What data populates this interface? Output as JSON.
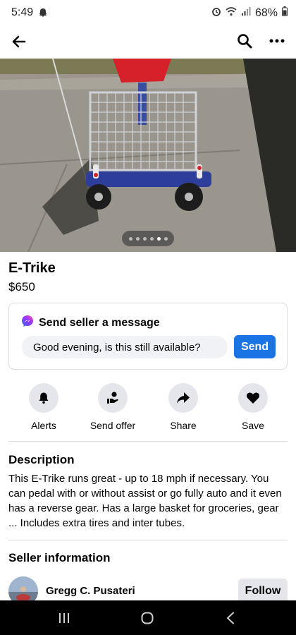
{
  "status": {
    "time": "5:49",
    "battery": "68%"
  },
  "listing": {
    "title": "E-Trike",
    "price": "$650"
  },
  "message": {
    "title": "Send seller a message",
    "input_value": "Good evening, is this still available?",
    "send_label": "Send"
  },
  "actions": [
    {
      "label": "Alerts",
      "icon": "bell-icon"
    },
    {
      "label": "Send offer",
      "icon": "offer-icon"
    },
    {
      "label": "Share",
      "icon": "share-icon"
    },
    {
      "label": "Save",
      "icon": "heart-icon"
    }
  ],
  "description": {
    "heading": "Description",
    "text": "This E-Trike runs great - up to 18 mph if necessary. You can pedal with or without assist or go fully auto and it even has a reverse gear.  Has a large basket for groceries, gear ...  Includes extra tires and inter tubes."
  },
  "seller": {
    "heading": "Seller information",
    "name": "Gregg C. Pusateri",
    "follow_label": "Follow"
  },
  "photo": {
    "dot_count": 6,
    "active_dot": 5
  },
  "colors": {
    "accent": "#1b74e4",
    "button_bg": "#e4e6eb",
    "input_bg": "#f0f2f5"
  }
}
